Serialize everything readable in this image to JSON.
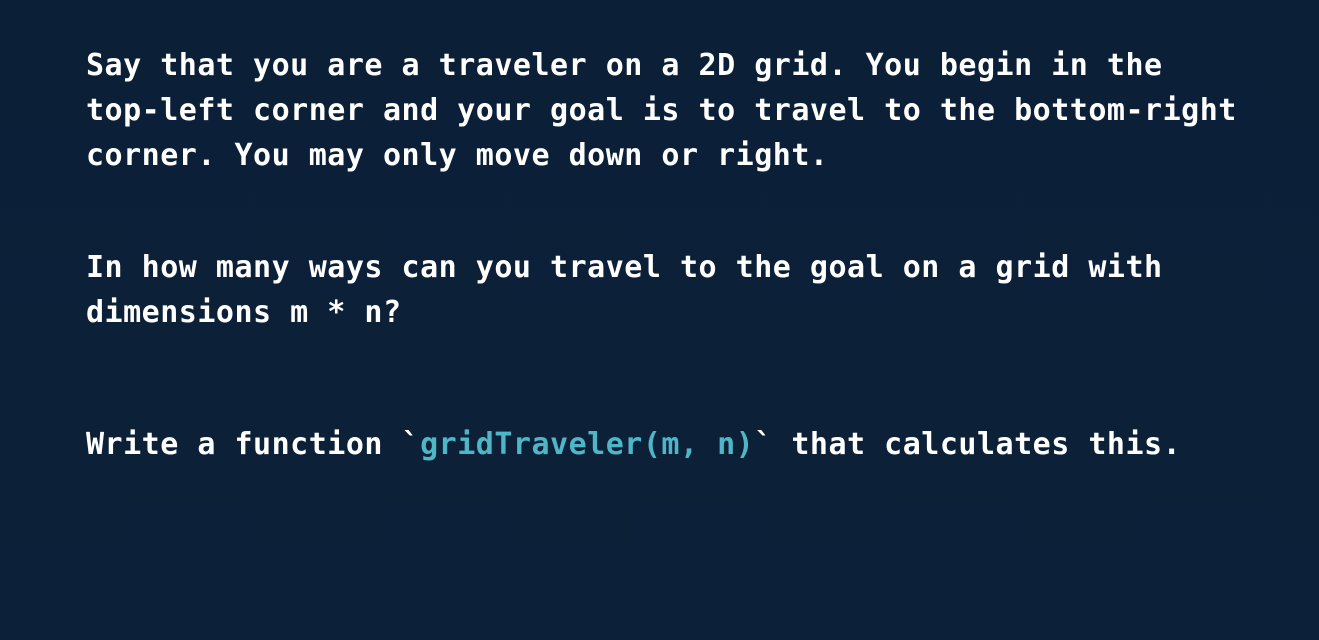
{
  "slide": {
    "paragraph1": {
      "line1": "Say that you are a traveler on a 2D grid. You begin in the",
      "line2": "top-left corner and your goal is to travel to the bottom-right",
      "line3": "corner. You may only move down or right."
    },
    "paragraph2": {
      "line1": "In how many ways can you travel to the goal on a grid with",
      "line2": "dimensions m * n?"
    },
    "paragraph3": {
      "prefix": "Write a function `",
      "code": "gridTraveler(m, n)",
      "suffix": "` that calculates this."
    }
  },
  "colors": {
    "background": "#0c2039",
    "text": "#ffffff",
    "code": "#4fb6c8"
  }
}
